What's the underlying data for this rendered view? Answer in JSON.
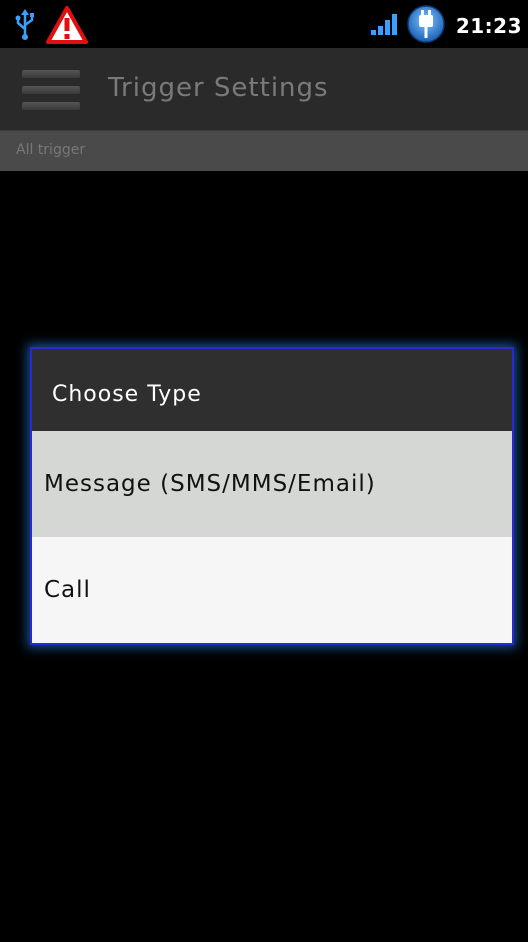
{
  "status_bar": {
    "time": "21:23",
    "icons": [
      "usb-icon",
      "warning-icon",
      "signal-icon",
      "battery-charging-icon"
    ]
  },
  "action_bar": {
    "title": "Trigger Settings",
    "menu_icon": "hamburger-menu-icon"
  },
  "section": {
    "label": "All trigger"
  },
  "dialog": {
    "title": "Choose Type",
    "options": [
      {
        "label": "Message (SMS/MMS/Email)",
        "selected": true
      },
      {
        "label": "Call",
        "selected": false
      }
    ]
  },
  "colors": {
    "dialog_border": "#2a2ad0",
    "dialog_glow": "#288cff",
    "warning": "#e01010",
    "usb": "#3aa0ff"
  }
}
